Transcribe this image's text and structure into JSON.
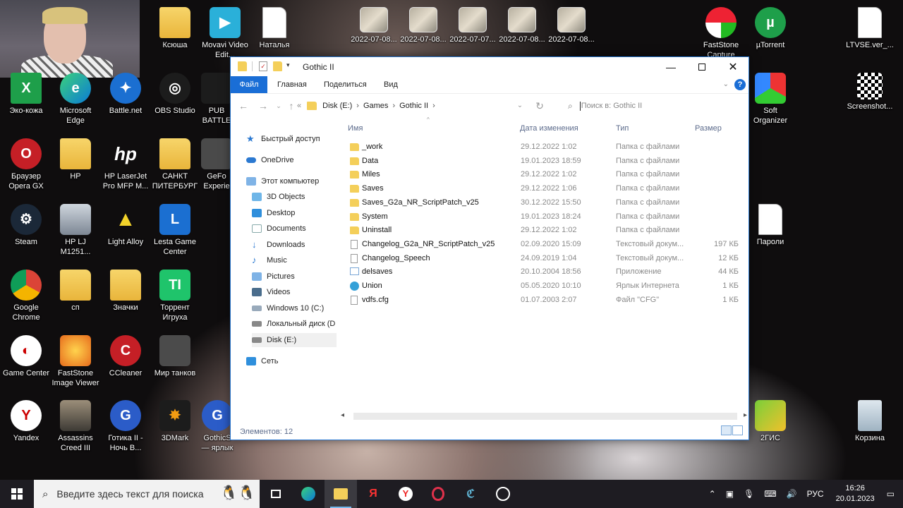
{
  "desktop": {
    "top_row": [
      "Ксюша",
      "Movavi Video Edit...",
      "Наталья",
      "2022-07-08...",
      "2022-07-08...",
      "2022-07-07...",
      "2022-07-08...",
      "2022-07-08..."
    ],
    "right_icons": [
      "FastStone Capture",
      "µTorrent",
      "LTVSE.ver_...",
      "Soft Organizer",
      "Screenshot...",
      "Пароли",
      "2ГИС",
      "Корзина"
    ],
    "left_icons": [
      "Эко-кожа",
      "Microsoft Edge",
      "Battle.net",
      "OBS Studio",
      "PUB BATTLE",
      "Браузер Opera GX",
      "HP",
      "HP LaserJet Pro MFP M...",
      "САНКТ ПИТЕРБУРГ",
      "GeFo Experie",
      "Steam",
      "HP LJ M1251...",
      "Light Alloy",
      "Lesta Game Center",
      "Google Chrome",
      "сп",
      "Значки",
      "Торрент Игруха",
      "Game Center",
      "FastStone Image Viewer",
      "CCleaner",
      "Мир танков",
      "Yandex",
      "Assassins Creed III",
      "Готика II - Ночь В...",
      "3DMark",
      "GothicS — ярлык"
    ]
  },
  "explorer": {
    "title": "Gothic II",
    "ribbon_tabs": [
      "Файл",
      "Главная",
      "Поделиться",
      "Вид"
    ],
    "help": "?",
    "path": [
      "Disk (E:)",
      "Games",
      "Gothic II"
    ],
    "path_prefix": "«",
    "search_placeholder": "Поиск в: Gothic II",
    "nav": {
      "quick_access": "Быстрый доступ",
      "onedrive": "OneDrive",
      "this_pc": "Этот компьютер",
      "items": [
        "3D Objects",
        "Desktop",
        "Documents",
        "Downloads",
        "Music",
        "Pictures",
        "Videos",
        "Windows 10 (C:)",
        "Локальный диск (D",
        "Disk (E:)"
      ],
      "network": "Сеть"
    },
    "columns": {
      "name": "Имя",
      "date": "Дата изменения",
      "type": "Тип",
      "size": "Размер"
    },
    "files": [
      {
        "name": "_work",
        "date": "29.12.2022 1:02",
        "type": "Папка с файлами",
        "size": "",
        "kind": "folder"
      },
      {
        "name": "Data",
        "date": "19.01.2023 18:59",
        "type": "Папка с файлами",
        "size": "",
        "kind": "folder"
      },
      {
        "name": "Miles",
        "date": "29.12.2022 1:02",
        "type": "Папка с файлами",
        "size": "",
        "kind": "folder"
      },
      {
        "name": "Saves",
        "date": "29.12.2022 1:06",
        "type": "Папка с файлами",
        "size": "",
        "kind": "folder"
      },
      {
        "name": "Saves_G2a_NR_ScriptPatch_v25",
        "date": "30.12.2022 15:50",
        "type": "Папка с файлами",
        "size": "",
        "kind": "folder"
      },
      {
        "name": "System",
        "date": "19.01.2023 18:24",
        "type": "Папка с файлами",
        "size": "",
        "kind": "folder"
      },
      {
        "name": "Uninstall",
        "date": "29.12.2022 1:02",
        "type": "Папка с файлами",
        "size": "",
        "kind": "folder"
      },
      {
        "name": "Changelog_G2a_NR_ScriptPatch_v25",
        "date": "02.09.2020 15:09",
        "type": "Текстовый докум...",
        "size": "197 КБ",
        "kind": "file"
      },
      {
        "name": "Changelog_Speech",
        "date": "24.09.2019 1:04",
        "type": "Текстовый докум...",
        "size": "12 КБ",
        "kind": "file"
      },
      {
        "name": "delsaves",
        "date": "20.10.2004 18:56",
        "type": "Приложение",
        "size": "44 КБ",
        "kind": "app"
      },
      {
        "name": "Union",
        "date": "05.05.2020 10:10",
        "type": "Ярлык Интернета",
        "size": "1 КБ",
        "kind": "url"
      },
      {
        "name": "vdfs.cfg",
        "date": "01.07.2003 2:07",
        "type": "Файл \"CFG\"",
        "size": "1 КБ",
        "kind": "file"
      }
    ],
    "status": "Элементов: 12"
  },
  "taskbar": {
    "search_placeholder": "Введите здесь текст для поиска",
    "lang": "РУС",
    "time": "16:26",
    "date": "20.01.2023"
  }
}
